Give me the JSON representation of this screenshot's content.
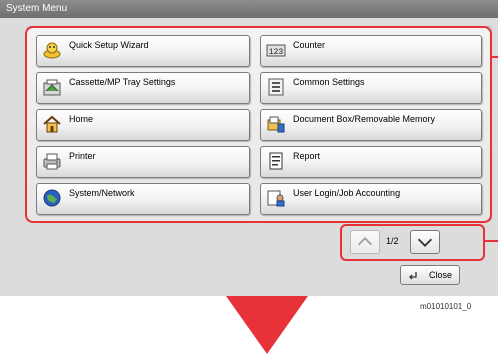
{
  "window": {
    "title": "System Menu"
  },
  "menu": {
    "left": [
      {
        "label": "Quick Setup Wizard",
        "icon": "wizard-icon"
      },
      {
        "label": "Cassette/MP Tray Settings",
        "icon": "tray-icon"
      },
      {
        "label": "Home",
        "icon": "home-icon"
      },
      {
        "label": "Printer",
        "icon": "printer-icon"
      },
      {
        "label": "System/Network",
        "icon": "globe-icon"
      }
    ],
    "right": [
      {
        "label": "Counter",
        "icon": "counter-icon"
      },
      {
        "label": "Common Settings",
        "icon": "settings-icon"
      },
      {
        "label": "Document Box/Removable Memory",
        "icon": "document-box-icon"
      },
      {
        "label": "Report",
        "icon": "report-icon"
      },
      {
        "label": "User Login/Job Accounting",
        "icon": "user-login-icon"
      }
    ]
  },
  "pagination": {
    "page": "1/2"
  },
  "close": {
    "label": "Close"
  },
  "figure_code": "m01010101_0",
  "colors": {
    "highlight": "#e8323a",
    "title_bar": "#7a7a7a"
  }
}
